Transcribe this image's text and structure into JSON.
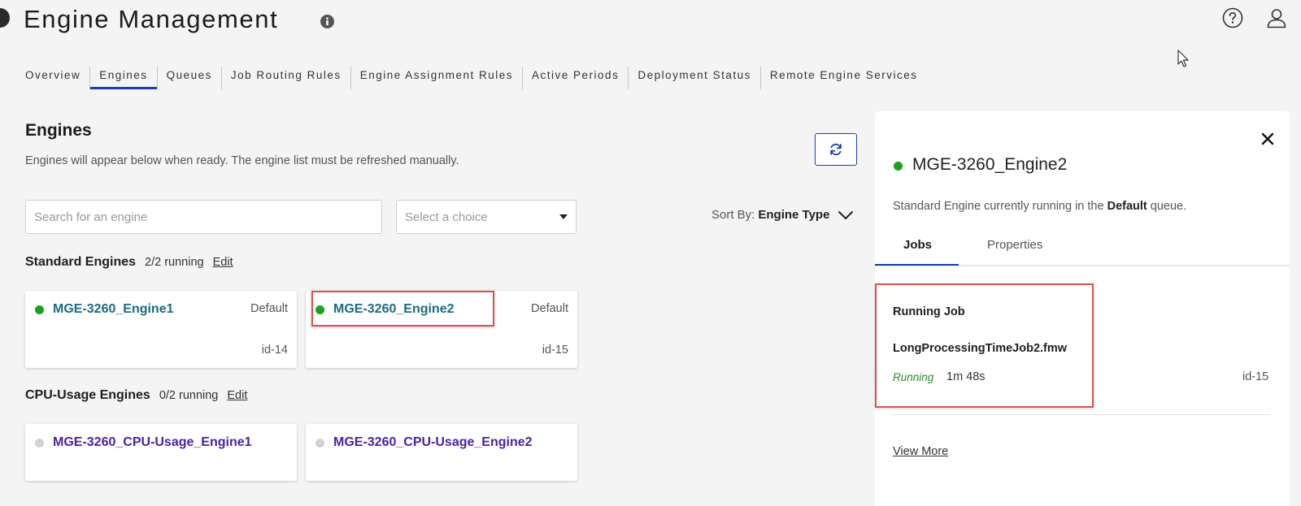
{
  "header": {
    "title": "Engine Management"
  },
  "tabs": [
    {
      "label": "Overview",
      "active": false
    },
    {
      "label": "Engines",
      "active": true
    },
    {
      "label": "Queues",
      "active": false
    },
    {
      "label": "Job Routing Rules",
      "active": false
    },
    {
      "label": "Engine Assignment Rules",
      "active": false
    },
    {
      "label": "Active Periods",
      "active": false
    },
    {
      "label": "Deployment Status",
      "active": false
    },
    {
      "label": "Remote Engine Services",
      "active": false
    }
  ],
  "main": {
    "title": "Engines",
    "description": "Engines will appear below when ready. The engine list must be refreshed manually.",
    "search_placeholder": "Search for an engine",
    "select_placeholder": "Select a choice",
    "sort_label": "Sort By:",
    "sort_value": "Engine Type"
  },
  "groups": {
    "standard": {
      "name": "Standard Engines",
      "count": "2/2 running",
      "edit": "Edit",
      "engines": [
        {
          "name": "MGE-3260_Engine1",
          "queue": "Default",
          "id": "id-14",
          "status": "running"
        },
        {
          "name": "MGE-3260_Engine2",
          "queue": "Default",
          "id": "id-15",
          "status": "running"
        }
      ]
    },
    "cpu": {
      "name": "CPU-Usage Engines",
      "count": "0/2 running",
      "edit": "Edit",
      "engines": [
        {
          "name": "MGE-3260_CPU-Usage_Engine1",
          "status": "stopped"
        },
        {
          "name": "MGE-3260_CPU-Usage_Engine2",
          "status": "stopped"
        }
      ]
    }
  },
  "panel": {
    "title": "MGE-3260_Engine2",
    "desc_prefix": "Standard Engine currently running in the",
    "desc_queue": "Default",
    "desc_suffix": "queue.",
    "tabs": [
      "Jobs",
      "Properties"
    ],
    "job_label": "Running Job",
    "job_name": "LongProcessingTimeJob2.fmw",
    "job_status": "Running",
    "job_time": "1m 48s",
    "job_id": "id-15",
    "view_more": "View More"
  },
  "colors": {
    "accent": "#1a3fb4",
    "running": "#1aa31a",
    "stopped": "#d3d3d3",
    "running_link": "#1d6a80",
    "stopped_link": "#4b1fa6",
    "highlight": "#d9534f"
  },
  "icons": [
    "info-icon",
    "help-icon",
    "user-icon",
    "refresh-icon",
    "chevron-down-icon",
    "close-icon",
    "cursor-icon"
  ]
}
